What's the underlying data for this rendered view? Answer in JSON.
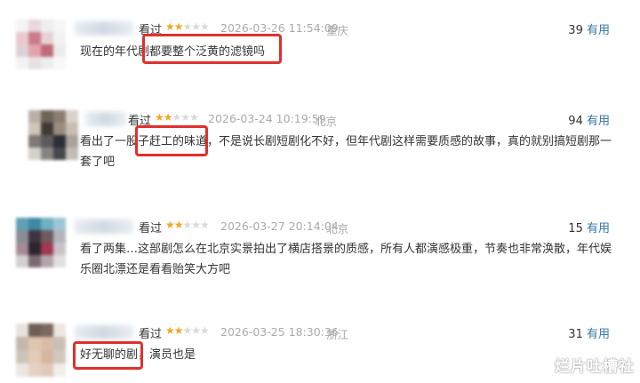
{
  "reviews": [
    {
      "watched": "看过",
      "rating": 2,
      "time": "2026-03-26 11:54:09",
      "location": "重庆",
      "useful_count": "39",
      "useful_label": "有用",
      "text": "现在的年代剧都要整个泛黄的滤镜吗"
    },
    {
      "watched": "看过",
      "rating": 2,
      "time": "2026-03-24 10:19:59",
      "location": "北京",
      "useful_count": "94",
      "useful_label": "有用",
      "text": "看出了一股子赶工的味道，不是说长剧短剧化不好，但年代剧这样需要质感的故事，真的就别搞短剧那一套了吧"
    },
    {
      "watched": "看过",
      "rating": 2,
      "time": "2026-03-27 20:14:04",
      "location": "北京",
      "useful_count": "15",
      "useful_label": "有用",
      "text": "看了两集…这部剧怎么在北京实景拍出了横店搭景的质感，所有人都演感极重，节奏也非常涣散，年代娱乐圈北漂还是看看贻笑大方吧"
    },
    {
      "watched": "看过",
      "rating": 2,
      "time": "2026-03-25 18:30:36",
      "location": "浙江",
      "useful_count": "31",
      "useful_label": "有用",
      "text": "好无聊的剧，演员也是"
    }
  ],
  "watermark": "烂片吐槽社"
}
